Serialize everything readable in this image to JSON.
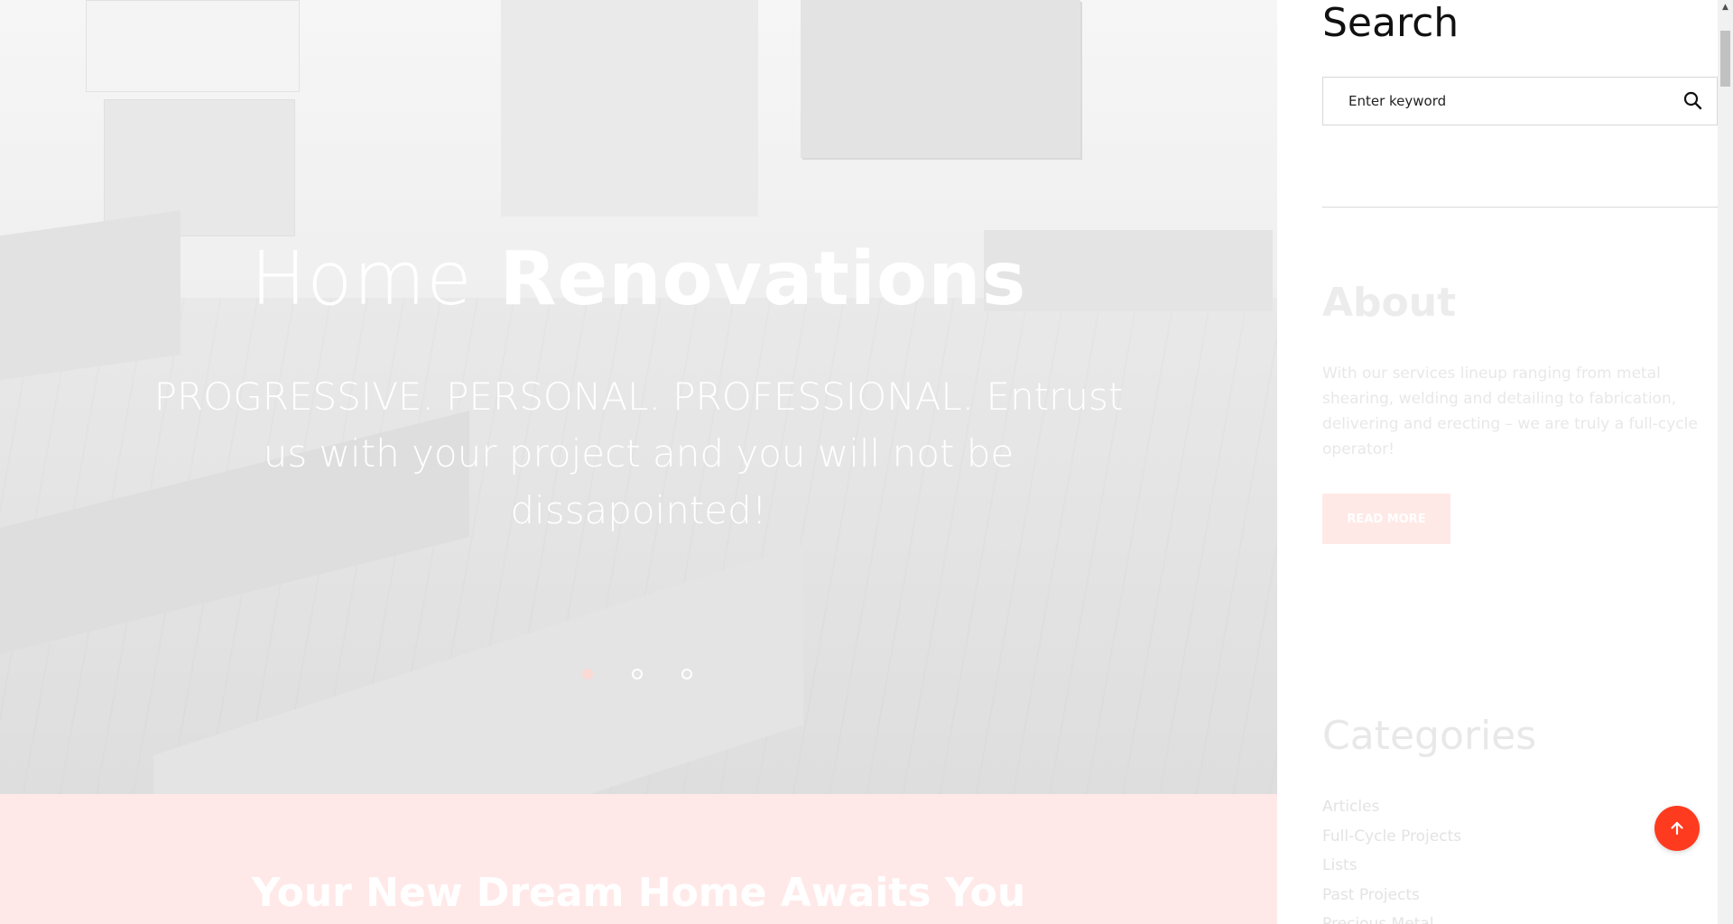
{
  "hero": {
    "title_light": "Home",
    "title_bold": "Renovations",
    "subtitle": "PROGRESSIVE. PERSONAL. PROFESSIONAL. Entrust us with your project and you will not be dissapointed!",
    "slides": {
      "count": 3,
      "active_index": 0
    }
  },
  "band": {
    "title_bold": "Your New Dream",
    "title_light": "Home Awaits You"
  },
  "sidebar": {
    "search": {
      "title": "Search",
      "placeholder": "Enter keyword",
      "icon": "search-icon"
    },
    "about": {
      "title": "About",
      "text": "With our services lineup ranging from metal shearing, welding and detailing to fabrication, delivering and erecting – we are truly a full-cycle operator!",
      "button_label": "READ MORE"
    },
    "categories": {
      "title": "Categories",
      "items": [
        "Articles",
        "Full-Cycle Projects",
        "Lists",
        "Past Projects",
        "Precious Metal"
      ]
    }
  },
  "back_to_top": {
    "icon": "arrow-up-icon",
    "color": "#ff3b1f"
  },
  "colors": {
    "accent": "#ff3b1f",
    "band": "#ffe9e8"
  }
}
